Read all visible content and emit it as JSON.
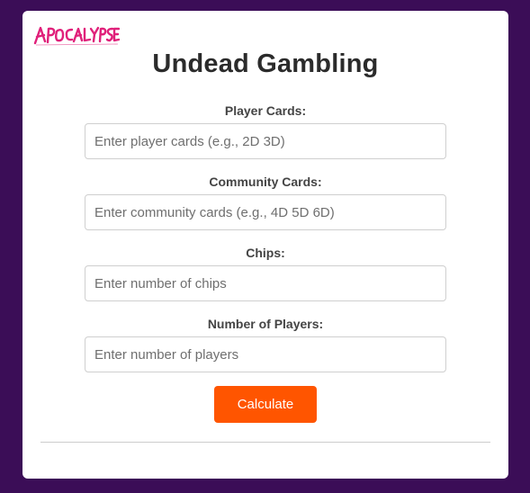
{
  "logo": {
    "text": "APOCALYPSE",
    "color": "#e0207a"
  },
  "page": {
    "title": "Undead Gambling",
    "background_color": "#3b0d57"
  },
  "form": {
    "fields": [
      {
        "label": "Player Cards:",
        "placeholder": "Enter player cards (e.g., 2D 3D)",
        "value": ""
      },
      {
        "label": "Community Cards:",
        "placeholder": "Enter community cards (e.g., 4D 5D 6D)",
        "value": ""
      },
      {
        "label": "Chips:",
        "placeholder": "Enter number of chips",
        "value": ""
      },
      {
        "label": "Number of Players:",
        "placeholder": "Enter number of players",
        "value": ""
      }
    ],
    "submit_label": "Calculate",
    "submit_color": "#ff5500"
  }
}
